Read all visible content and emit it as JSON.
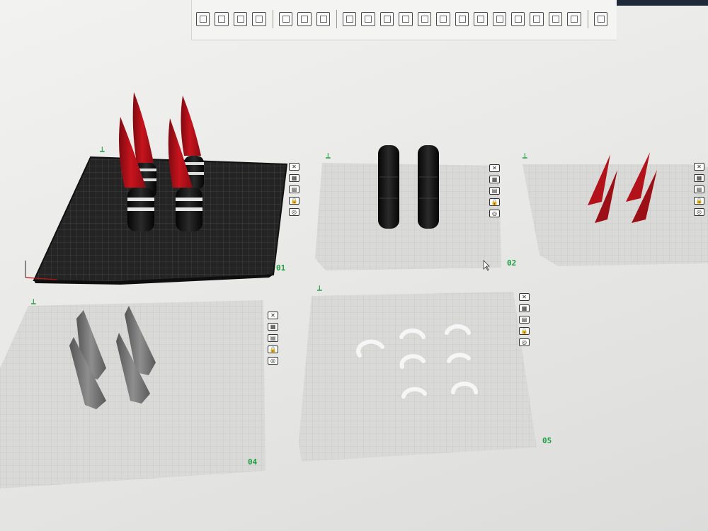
{
  "toolbar": {
    "tools": [
      {
        "icon": "add-object-icon"
      },
      {
        "icon": "arrange-grid-icon"
      },
      {
        "icon": "auto-orient-icon"
      },
      {
        "icon": "plate-layout-icon"
      },
      {
        "icon": "copy-icon"
      },
      {
        "icon": "paste-icon"
      },
      {
        "icon": "list-icon"
      },
      {
        "icon": "move-icon"
      },
      {
        "icon": "rotate-icon"
      },
      {
        "icon": "scale-icon"
      },
      {
        "icon": "lay-on-face-icon"
      },
      {
        "icon": "cut-icon"
      },
      {
        "icon": "mesh-boolean-icon"
      },
      {
        "icon": "support-paint-icon"
      },
      {
        "icon": "seam-paint-icon"
      },
      {
        "icon": "text-icon"
      },
      {
        "icon": "color-paint-icon"
      },
      {
        "icon": "measure-icon"
      },
      {
        "icon": "variable-layer-icon"
      },
      {
        "icon": "assembly-icon"
      },
      {
        "icon": "explode-icon"
      }
    ]
  },
  "plates": [
    {
      "id": "plate-1",
      "label": "01",
      "mark": "⟂",
      "selected": true,
      "model": "red-cone-tips"
    },
    {
      "id": "plate-2",
      "label": "02",
      "mark": "⟂",
      "selected": false,
      "model": "black-cylinders"
    },
    {
      "id": "plate-3",
      "label": "",
      "mark": "⟂",
      "selected": false,
      "model": "red-spikes"
    },
    {
      "id": "plate-4",
      "label": "04",
      "mark": "⟂",
      "selected": false,
      "model": "grey-cones"
    },
    {
      "id": "plate-5",
      "label": "05",
      "mark": "⟂",
      "selected": false,
      "model": "white-clips"
    }
  ],
  "plate_icons": [
    "✕",
    "▦",
    "▤",
    "🔒",
    "◎"
  ],
  "colors": {
    "accent_green": "#1e9e3e",
    "plate_grid": "#d7d7d7",
    "plate_dark": "#222222",
    "model_red": "#b3121b",
    "model_black": "#0d0d0d",
    "model_grey": "#707070",
    "model_white": "#f4f4f4"
  }
}
